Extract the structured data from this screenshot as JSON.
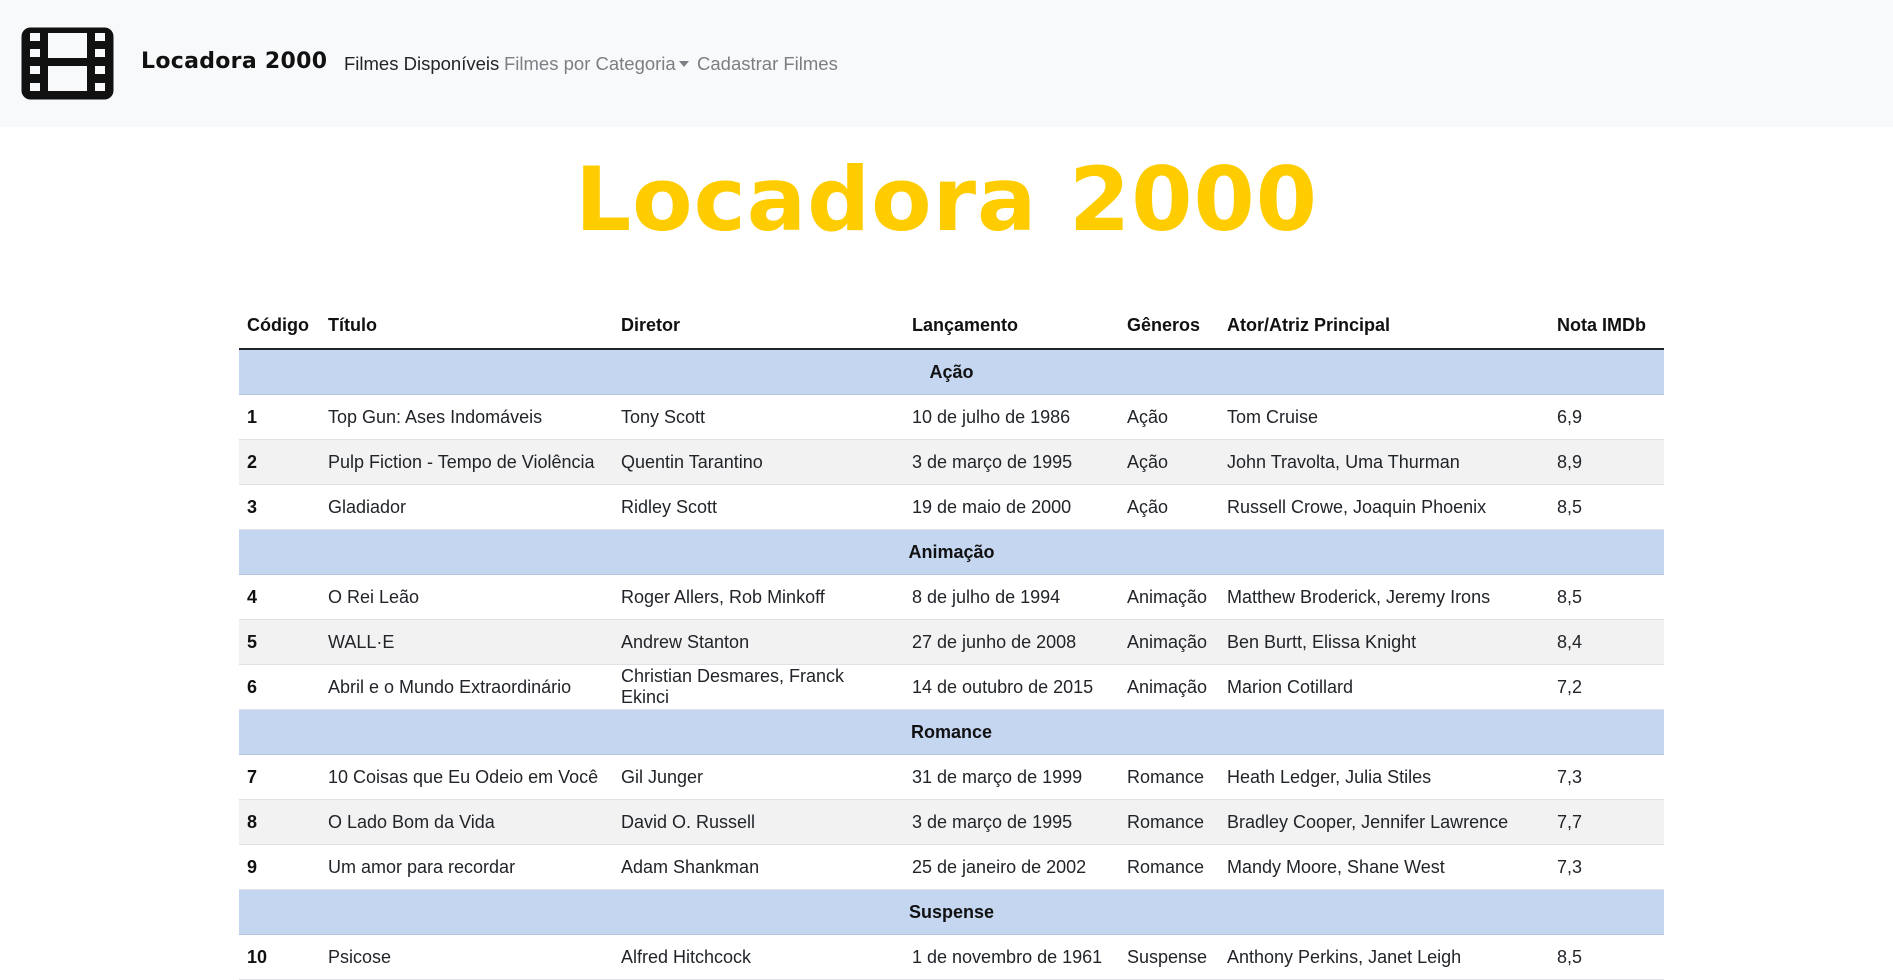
{
  "navbar": {
    "brand": "Locadora 2000",
    "links": [
      {
        "label": "Filmes Disponíveis"
      },
      {
        "label": "Filmes por Categoria"
      },
      {
        "label": "Cadastrar Filmes"
      }
    ]
  },
  "hero": {
    "title": "Locadora 2000"
  },
  "table": {
    "headers": [
      "Código",
      "Título",
      "Diretor",
      "Lançamento",
      "Gêneros",
      "Ator/Atriz Principal",
      "Nota IMDb"
    ],
    "categories": [
      {
        "name": "Ação",
        "rows": [
          [
            "1",
            "Top Gun: Ases Indomáveis",
            "Tony Scott",
            "10 de julho de 1986",
            "Ação",
            "Tom Cruise",
            "6,9"
          ],
          [
            "2",
            "Pulp Fiction - Tempo de Violência",
            "Quentin Tarantino",
            "3 de março de 1995",
            "Ação",
            "John Travolta, Uma Thurman",
            "8,9"
          ],
          [
            "3",
            "Gladiador",
            "Ridley Scott",
            "19 de maio de 2000",
            "Ação",
            "Russell Crowe, Joaquin Phoenix",
            "8,5"
          ]
        ]
      },
      {
        "name": "Animação",
        "rows": [
          [
            "4",
            "O Rei Leão",
            "Roger Allers, Rob Minkoff",
            "8 de julho de 1994",
            "Animação",
            "Matthew Broderick, Jeremy Irons",
            "8,5"
          ],
          [
            "5",
            "WALL·E",
            "Andrew Stanton",
            "27 de junho de 2008",
            "Animação",
            "Ben Burtt, Elissa Knight",
            "8,4"
          ],
          [
            "6",
            "Abril e o Mundo Extraordinário",
            "Christian Desmares, Franck Ekinci",
            "14 de outubro de 2015",
            "Animação",
            "Marion Cotillard",
            "7,2"
          ]
        ]
      },
      {
        "name": "Romance",
        "rows": [
          [
            "7",
            "10 Coisas que Eu Odeio em Você",
            "Gil Junger",
            "31 de março de 1999",
            "Romance",
            "Heath Ledger, Julia Stiles",
            "7,3"
          ],
          [
            "8",
            "O Lado Bom da Vida",
            "David O. Russell",
            "3 de março de 1995",
            "Romance",
            "Bradley Cooper, Jennifer Lawrence",
            "7,7"
          ],
          [
            "9",
            "Um amor para recordar",
            "Adam Shankman",
            "25 de janeiro de 2002",
            "Romance",
            "Mandy Moore, Shane West",
            "7,3"
          ]
        ]
      },
      {
        "name": "Suspense",
        "rows": [
          [
            "10",
            "Psicose",
            "Alfred Hitchcock",
            "1 de novembro de 1961",
            "Suspense",
            "Anthony Perkins, Janet Leigh",
            "8,5"
          ]
        ]
      }
    ]
  },
  "colors": {
    "accent": "#ffcc00",
    "category_row": "#c5d6f1",
    "navbar": "#f8f9fa"
  },
  "icons": {
    "logo": "film-strip-icon",
    "dropdown": "caret-down-icon"
  }
}
